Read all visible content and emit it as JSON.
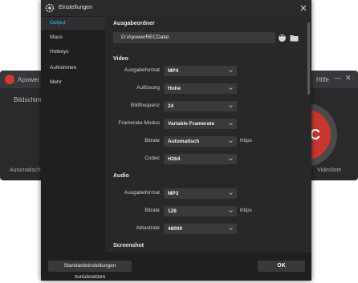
{
  "background_app": {
    "title": "Apower",
    "help": "Hilfe",
    "mode": "Bildschirm",
    "auto_label": "Automatische",
    "video_label": "Videoliste",
    "rec_label": "REC"
  },
  "dialog": {
    "title": "Einstellungen",
    "sidebar": {
      "items": [
        {
          "label": "Output",
          "active": true
        },
        {
          "label": "Maus",
          "active": false
        },
        {
          "label": "Hotkeys",
          "active": false
        },
        {
          "label": "Aufnehmen",
          "active": false
        },
        {
          "label": "Mehr",
          "active": false
        }
      ]
    },
    "output_folder": {
      "heading": "Ausgabeordner",
      "path": "D:\\ApowerRECData\\"
    },
    "video": {
      "heading": "Video",
      "rows": [
        {
          "label": "Ausgabeformat",
          "value": "MP4",
          "unit": ""
        },
        {
          "label": "Auflösung",
          "value": "Hohe",
          "unit": ""
        },
        {
          "label": "Bildfrequenz",
          "value": "24",
          "unit": ""
        },
        {
          "label": "Framerate-Modus",
          "value": "Variable Framerate",
          "unit": ""
        },
        {
          "label": "Bitrate",
          "value": "Automatisch",
          "unit": "Kbps"
        },
        {
          "label": "Codec",
          "value": "H264",
          "unit": ""
        }
      ]
    },
    "audio": {
      "heading": "Audio",
      "rows": [
        {
          "label": "Ausgabeformat",
          "value": "MP3",
          "unit": ""
        },
        {
          "label": "Bitrate",
          "value": "128",
          "unit": "Kbps"
        },
        {
          "label": "Abtastrate",
          "value": "48000",
          "unit": ""
        }
      ]
    },
    "screenshot": {
      "heading": "Screenshot"
    },
    "footer": {
      "reset_label": "Standardeinstellungen zurücksetzen",
      "ok_label": "OK"
    }
  },
  "colors": {
    "accent": "#2ec0f0",
    "rec_red": "#c8362f"
  }
}
